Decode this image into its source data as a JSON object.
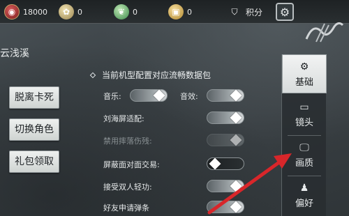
{
  "resources": [
    {
      "icon": "gold-coin-icon",
      "value": "18000"
    },
    {
      "icon": "bag-icon",
      "value": "0"
    },
    {
      "icon": "leaf-token-icon",
      "value": "0"
    },
    {
      "icon": "treasure-chest-icon",
      "value": "0"
    }
  ],
  "score": {
    "icon": "score-shield-icon",
    "label": "积分"
  },
  "page_title": "云浅溪",
  "left_buttons": [
    "脱离卡死",
    "切换角色",
    "礼包领取"
  ],
  "settings": {
    "section_title": "当前机型配置对应流畅数据包",
    "music_label": "音乐:",
    "music_on": true,
    "sfx_label": "音效:",
    "sfx_on": true,
    "notch_label": "刘海屏适配:",
    "notch_on": true,
    "fall_damage_label": "禁用摔落伤残:",
    "fall_damage_on": true,
    "fall_damage_disabled": true,
    "block_trade_label": "屏蔽面对面交易:",
    "block_trade_on": false,
    "duo_qinggong_label": "接受双人轻功:",
    "duo_qinggong_on": true,
    "friend_popup_label": "好友申请弹条",
    "friend_popup_on": true
  },
  "tabs": [
    {
      "icon": "gear-icon",
      "label": "基础",
      "active": true
    },
    {
      "icon": "camera-icon",
      "label": "镜头",
      "active": false
    },
    {
      "icon": "monitor-icon",
      "label": "画质",
      "active": false
    },
    {
      "icon": "person-icon",
      "label": "偏好",
      "active": false
    }
  ],
  "colors": {
    "annotation_arrow": "#d8262a",
    "tab_active_bg": "#eef0f0",
    "panel_bg": "#3d4448"
  }
}
